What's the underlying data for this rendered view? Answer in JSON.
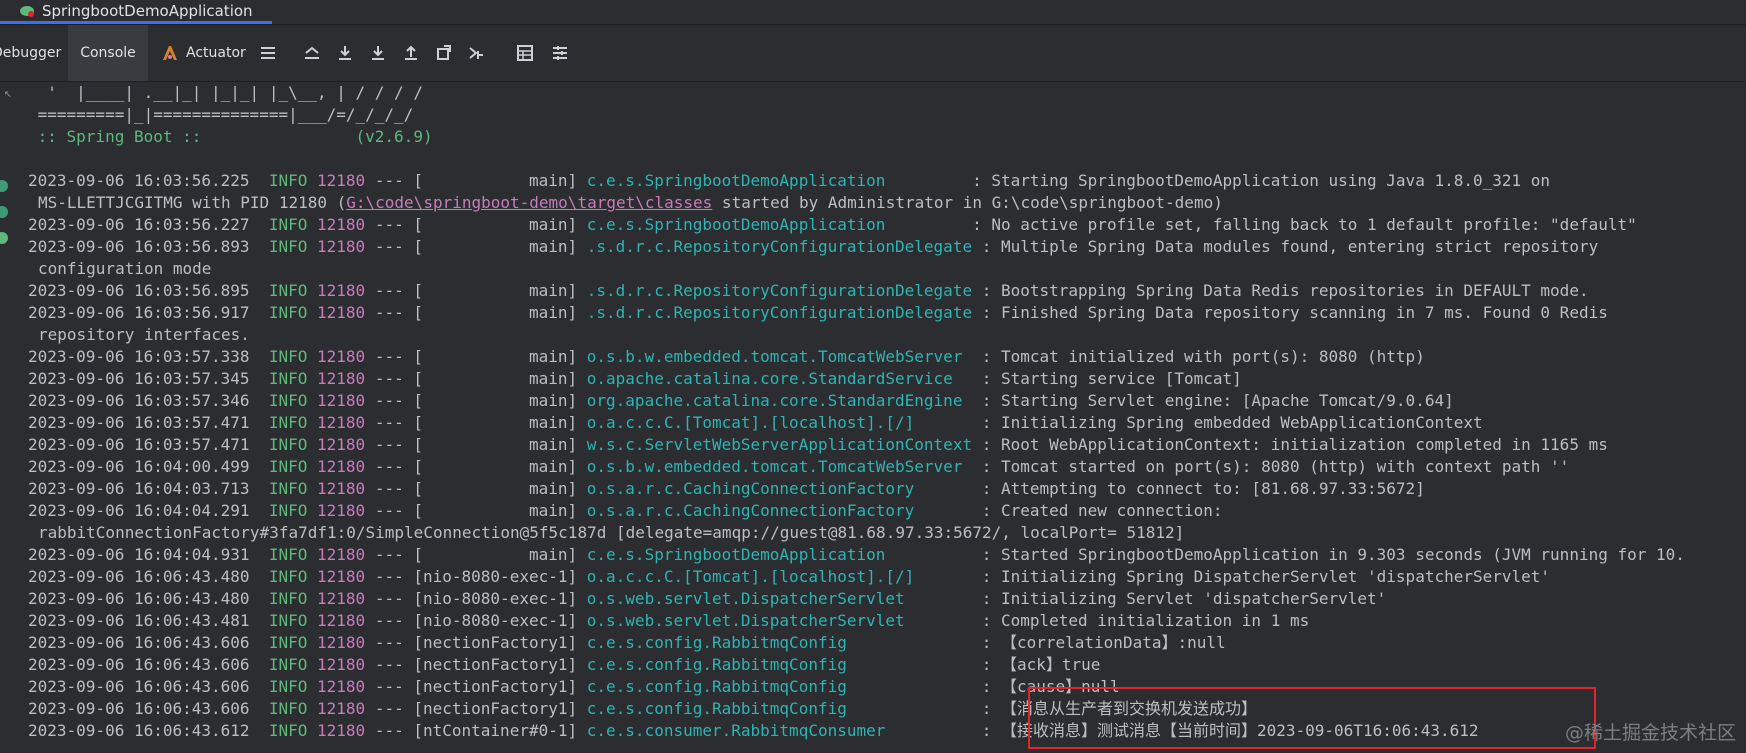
{
  "run_tab": {
    "label": "SpringbootDemoApplication"
  },
  "toolbar": {
    "debugger_label": "Debugger",
    "console_label": "Console",
    "actuator_label": "Actuator"
  },
  "banner": [
    "  '  |____| .__|_| |_|_| |_\\__, | / / / /",
    " =========|_|==============|___/=/_/_/_/",
    " :: Spring Boot ::                (v2.6.9)",
    ""
  ],
  "log": [
    {
      "ts": "2023-09-06 16:03:56.225",
      "lvl": "INFO",
      "pid": "12180",
      "sep": "---",
      "thread": "[           main]",
      "logger": "c.e.s.SpringbootDemoApplication         ",
      "msg": ": Starting SpringbootDemoApplication using Java 1.8.0_321 on"
    },
    {
      "cont": true,
      "pre": "MS-LLETTJCGITMG with PID 12180 (",
      "link": "G:\\code\\springboot-demo\\target\\classes",
      "post": " started by Administrator in G:\\code\\springboot-demo)"
    },
    {
      "ts": "2023-09-06 16:03:56.227",
      "lvl": "INFO",
      "pid": "12180",
      "sep": "---",
      "thread": "[           main]",
      "logger": "c.e.s.SpringbootDemoApplication         ",
      "msg": ": No active profile set, falling back to 1 default profile: \"default\""
    },
    {
      "ts": "2023-09-06 16:03:56.893",
      "lvl": "INFO",
      "pid": "12180",
      "sep": "---",
      "thread": "[           main]",
      "logger": ".s.d.r.c.RepositoryConfigurationDelegate",
      "msg": " : Multiple Spring Data modules found, entering strict repository"
    },
    {
      "cont": true,
      "text": "configuration mode"
    },
    {
      "ts": "2023-09-06 16:03:56.895",
      "lvl": "INFO",
      "pid": "12180",
      "sep": "---",
      "thread": "[           main]",
      "logger": ".s.d.r.c.RepositoryConfigurationDelegate",
      "msg": " : Bootstrapping Spring Data Redis repositories in DEFAULT mode."
    },
    {
      "ts": "2023-09-06 16:03:56.917",
      "lvl": "INFO",
      "pid": "12180",
      "sep": "---",
      "thread": "[           main]",
      "logger": ".s.d.r.c.RepositoryConfigurationDelegate",
      "msg": " : Finished Spring Data repository scanning in 7 ms. Found 0 Redis"
    },
    {
      "cont": true,
      "text": "repository interfaces."
    },
    {
      "ts": "2023-09-06 16:03:57.338",
      "lvl": "INFO",
      "pid": "12180",
      "sep": "---",
      "thread": "[           main]",
      "logger": "o.s.b.w.embedded.tomcat.TomcatWebServer ",
      "msg": " : Tomcat initialized with port(s): 8080 (http)"
    },
    {
      "ts": "2023-09-06 16:03:57.345",
      "lvl": "INFO",
      "pid": "12180",
      "sep": "---",
      "thread": "[           main]",
      "logger": "o.apache.catalina.core.StandardService  ",
      "msg": " : Starting service [Tomcat]"
    },
    {
      "ts": "2023-09-06 16:03:57.346",
      "lvl": "INFO",
      "pid": "12180",
      "sep": "---",
      "thread": "[           main]",
      "logger": "org.apache.catalina.core.StandardEngine ",
      "msg": " : Starting Servlet engine: [Apache Tomcat/9.0.64]"
    },
    {
      "ts": "2023-09-06 16:03:57.471",
      "lvl": "INFO",
      "pid": "12180",
      "sep": "---",
      "thread": "[           main]",
      "logger": "o.a.c.c.C.[Tomcat].[localhost].[/]      ",
      "msg": " : Initializing Spring embedded WebApplicationContext"
    },
    {
      "ts": "2023-09-06 16:03:57.471",
      "lvl": "INFO",
      "pid": "12180",
      "sep": "---",
      "thread": "[           main]",
      "logger": "w.s.c.ServletWebServerApplicationContext",
      "msg": " : Root WebApplicationContext: initialization completed in 1165 ms"
    },
    {
      "ts": "2023-09-06 16:04:00.499",
      "lvl": "INFO",
      "pid": "12180",
      "sep": "---",
      "thread": "[           main]",
      "logger": "o.s.b.w.embedded.tomcat.TomcatWebServer ",
      "msg": " : Tomcat started on port(s): 8080 (http) with context path ''"
    },
    {
      "ts": "2023-09-06 16:04:03.713",
      "lvl": "INFO",
      "pid": "12180",
      "sep": "---",
      "thread": "[           main]",
      "logger": "o.s.a.r.c.CachingConnectionFactory      ",
      "msg": " : Attempting to connect to: [81.68.97.33:5672]"
    },
    {
      "ts": "2023-09-06 16:04:04.291",
      "lvl": "INFO",
      "pid": "12180",
      "sep": "---",
      "thread": "[           main]",
      "logger": "o.s.a.r.c.CachingConnectionFactory      ",
      "msg": " : Created new connection:"
    },
    {
      "cont": true,
      "text": "rabbitConnectionFactory#3fa7df1:0/SimpleConnection@5f5c187d [delegate=amqp://guest@81.68.97.33:5672/, localPort= 51812]"
    },
    {
      "ts": "2023-09-06 16:04:04.931",
      "lvl": "INFO",
      "pid": "12180",
      "sep": "---",
      "thread": "[           main]",
      "logger": "c.e.s.SpringbootDemoApplication         ",
      "msg": " : Started SpringbootDemoApplication in 9.303 seconds (JVM running for 10."
    },
    {
      "ts": "2023-09-06 16:06:43.480",
      "lvl": "INFO",
      "pid": "12180",
      "sep": "---",
      "thread": "[nio-8080-exec-1]",
      "logger": "o.a.c.c.C.[Tomcat].[localhost].[/]      ",
      "msg": " : Initializing Spring DispatcherServlet 'dispatcherServlet'"
    },
    {
      "ts": "2023-09-06 16:06:43.480",
      "lvl": "INFO",
      "pid": "12180",
      "sep": "---",
      "thread": "[nio-8080-exec-1]",
      "logger": "o.s.web.servlet.DispatcherServlet       ",
      "msg": " : Initializing Servlet 'dispatcherServlet'"
    },
    {
      "ts": "2023-09-06 16:06:43.481",
      "lvl": "INFO",
      "pid": "12180",
      "sep": "---",
      "thread": "[nio-8080-exec-1]",
      "logger": "o.s.web.servlet.DispatcherServlet       ",
      "msg": " : Completed initialization in 1 ms"
    },
    {
      "ts": "2023-09-06 16:06:43.606",
      "lvl": "INFO",
      "pid": "12180",
      "sep": "---",
      "thread": "[nectionFactory1]",
      "logger": "c.e.s.config.RabbitmqConfig             ",
      "msg": " : 【correlationData】:null"
    },
    {
      "ts": "2023-09-06 16:06:43.606",
      "lvl": "INFO",
      "pid": "12180",
      "sep": "---",
      "thread": "[nectionFactory1]",
      "logger": "c.e.s.config.RabbitmqConfig             ",
      "msg": " : 【ack】true"
    },
    {
      "ts": "2023-09-06 16:06:43.606",
      "lvl": "INFO",
      "pid": "12180",
      "sep": "---",
      "thread": "[nectionFactory1]",
      "logger": "c.e.s.config.RabbitmqConfig             ",
      "msg": " : 【cause】null"
    },
    {
      "ts": "2023-09-06 16:06:43.606",
      "lvl": "INFO",
      "pid": "12180",
      "sep": "---",
      "thread": "[nectionFactory1]",
      "logger": "c.e.s.config.RabbitmqConfig             ",
      "msg": " : 【消息从生产者到交换机发送成功】"
    },
    {
      "ts": "2023-09-06 16:06:43.612",
      "lvl": "INFO",
      "pid": "12180",
      "sep": "---",
      "thread": "[ntContainer#0-1]",
      "logger": "c.e.s.consumer.RabbitmqConsumer         ",
      "msg": " : 【接收消息】测试消息【当前时间】2023-09-06T16:06:43.612"
    }
  ],
  "watermark": "@稀土掘金技术社区",
  "colors": {
    "accent": "#3574f0",
    "highlight_border": "#e0262a",
    "info": "#5fb87c",
    "pid": "#c77dbb",
    "logger": "#2fb4b4"
  }
}
